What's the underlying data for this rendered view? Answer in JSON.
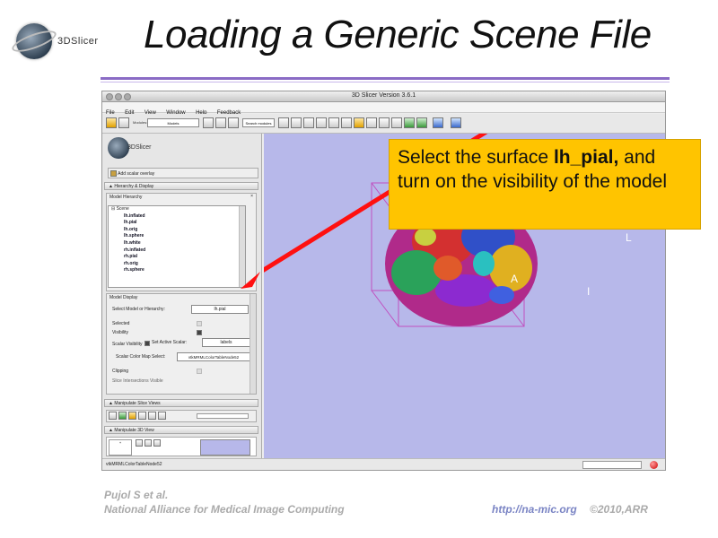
{
  "slide": {
    "title": "Loading a Generic Scene File",
    "logo_text": "3DSlicer",
    "footer_author": "Pujol S et al.",
    "footer_org": "National Alliance for Medical Image Computing",
    "footer_url": "http://na-mic.org",
    "footer_copyright": "©2010,ARR",
    "accent_color": "#8a6bc5"
  },
  "window": {
    "title": "3D Slicer Version 3.6.1",
    "menu": [
      "File",
      "Edit",
      "View",
      "Window",
      "Help",
      "Feedback"
    ],
    "toolbar": {
      "modules_label": "Modules:",
      "module_selected": "Models",
      "search_placeholder": "Search modules"
    }
  },
  "left_panel": {
    "logo_text": "3DSlicer",
    "add_scalar_overlay": "Add scalar overlay",
    "hierarchy_section": "Hierarchy & Display",
    "model_hierarchy_group": "Model Hierarchy",
    "tree": {
      "root": "Scene",
      "items": [
        "lh.inflated",
        "lh.pial",
        "lh.orig",
        "lh.sphere",
        "lh.white",
        "rh.inflated",
        "rh.pial",
        "rh.orig",
        "rh.sphere"
      ]
    },
    "model_display": {
      "group_label": "Model Display",
      "select_label": "Select Model or Hierarchy:",
      "selected_model": "lh.pial",
      "selected_label": "Selected",
      "visibility_label": "Visibility",
      "visibility_on": true,
      "scalar_visibility_label": "Scalar Visibility",
      "set_active_scalar_label": "Set Active Scalar:",
      "active_scalar": "labels",
      "color_map_label": "Scalar Color Map Select:",
      "color_map": "vtkMRMLColorTableNode52",
      "clipping_label": "Clipping",
      "slice_intersections_label": "Slice Intersections Visible"
    },
    "manipulate_slice_views": "Manipulate Slice Views",
    "manipulate_3d_view": "Manipulate 3D View"
  },
  "view3d": {
    "background_color": "#b7b8ea",
    "orientation_labels": {
      "anterior": "A",
      "left": "L",
      "inferior": "I"
    }
  },
  "status_bar": {
    "text": "vtkMRMLColorTableNode52"
  },
  "callout": {
    "text_before": "Select the surface ",
    "bold": "lh_pial,",
    "text_after": "and turn on the visibility of the model",
    "color": "#ffc400"
  }
}
